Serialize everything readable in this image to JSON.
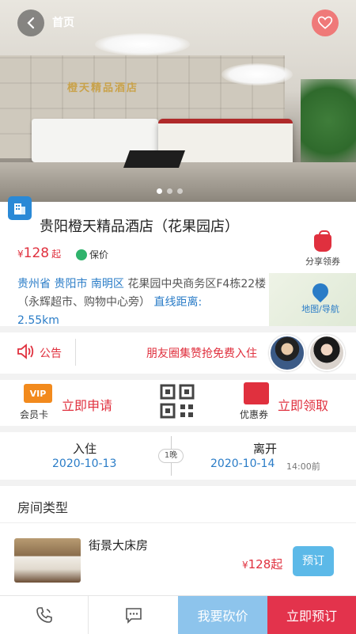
{
  "header": {
    "title": "首页"
  },
  "hotel": {
    "name": "贵阳橙天精品酒店（花果园店）",
    "price_symbol": "¥",
    "price": "128",
    "price_unit": "起",
    "guarantee_label": "保价",
    "share_label": "分享领券",
    "address_blue_1": "贵州省 贵阳市 南明区",
    "address_text": " 花果园中央商务区F4栋22楼（永辉超市、购物中心旁） ",
    "distance_label": "直线距离:",
    "distance_value": "2.55km",
    "map_nav_label": "地图/导航",
    "sign_text": "橙天精品酒店"
  },
  "notice": {
    "label": "公告",
    "text": "朋友圈集赞抢免费入住"
  },
  "membership": {
    "vip_badge": "VIP",
    "card_label": "会员卡",
    "card_action": "立即申请",
    "coupon_label": "优惠券",
    "coupon_action": "立即领取"
  },
  "dates": {
    "checkin_label": "入住",
    "checkin_date": "2020-10-13",
    "nights": "1晚",
    "checkout_label": "离开",
    "checkout_date": "2020-10-14",
    "checkout_time": "14:00前"
  },
  "rooms": {
    "section_title": "房间类型",
    "items": [
      {
        "name": "街景大床房",
        "price_symbol": "¥",
        "price": "128起",
        "book_label": "预订"
      }
    ]
  },
  "bottom_bar": {
    "bargain_label": "我要砍价",
    "book_label": "立即预订"
  },
  "colors": {
    "accent_red": "#e0303e",
    "accent_blue": "#2a7cc7",
    "bargain_blue": "#8dc4ec",
    "book_red": "#e3334c"
  },
  "icons": [
    "back-arrow-icon",
    "heart-icon",
    "hotel-building-icon",
    "shield-icon",
    "red-bag-icon",
    "map-pin-icon",
    "speaker-icon",
    "vip-card-icon",
    "qr-code-icon",
    "coupon-icon",
    "phone-icon",
    "chat-icon"
  ]
}
